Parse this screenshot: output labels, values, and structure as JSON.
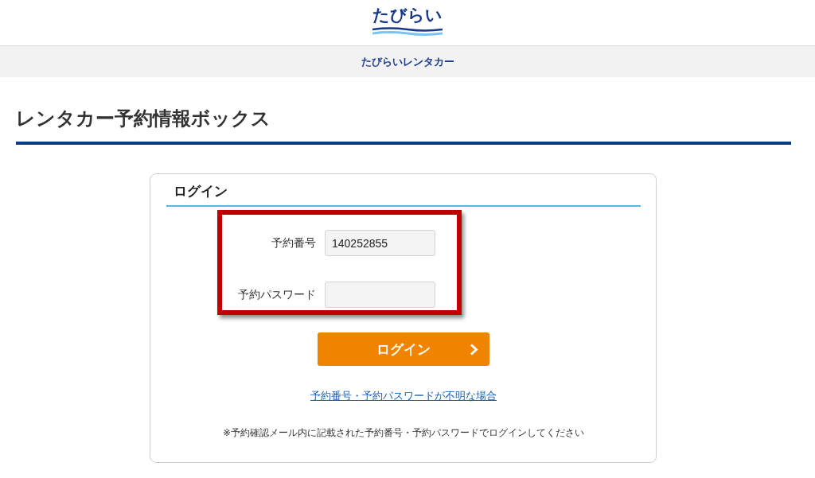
{
  "header": {
    "logo": "たびらい"
  },
  "nav": {
    "title": "たびらいレンタカー"
  },
  "page": {
    "title": "レンタカー予約情報ボックス"
  },
  "login_panel": {
    "title": "ログイン",
    "fields": [
      {
        "label": "予約番号",
        "value": "140252855"
      },
      {
        "label": "予約パスワード"
      }
    ],
    "button": {
      "label": "ログイン"
    },
    "help_link": "予約番号・予約パスワードが不明な場合",
    "note": "※予約確認メール内に記載された予約番号・予約パスワードでログインしてください"
  }
}
